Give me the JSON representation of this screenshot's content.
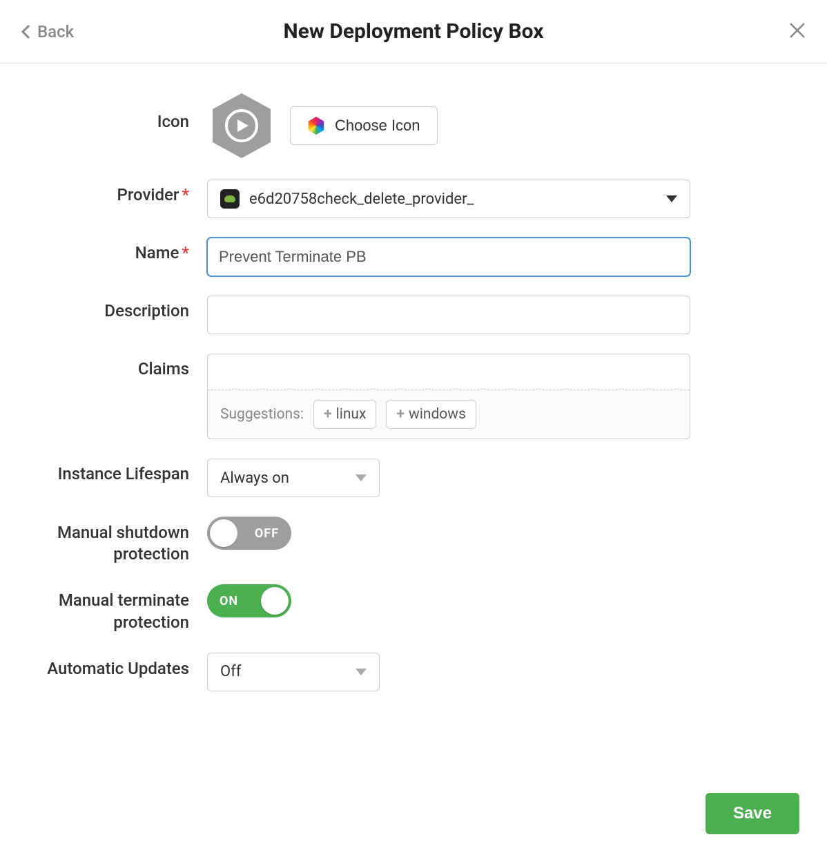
{
  "header": {
    "back_label": "Back",
    "title": "New Deployment Policy Box"
  },
  "form": {
    "icon": {
      "label": "Icon",
      "choose_label": "Choose Icon"
    },
    "provider": {
      "label": "Provider",
      "required": true,
      "value": "e6d20758check_delete_provider_"
    },
    "name": {
      "label": "Name",
      "required": true,
      "value": "Prevent Terminate PB"
    },
    "description": {
      "label": "Description",
      "value": ""
    },
    "claims": {
      "label": "Claims",
      "suggestions_label": "Suggestions:",
      "suggestions": [
        "linux",
        "windows"
      ]
    },
    "instance_lifespan": {
      "label": "Instance Lifespan",
      "value": "Always on"
    },
    "shutdown_protection": {
      "label": "Manual shutdown protection",
      "state": "OFF"
    },
    "terminate_protection": {
      "label": "Manual terminate protection",
      "state": "ON"
    },
    "auto_updates": {
      "label": "Automatic Updates",
      "value": "Off"
    }
  },
  "footer": {
    "save_label": "Save"
  }
}
